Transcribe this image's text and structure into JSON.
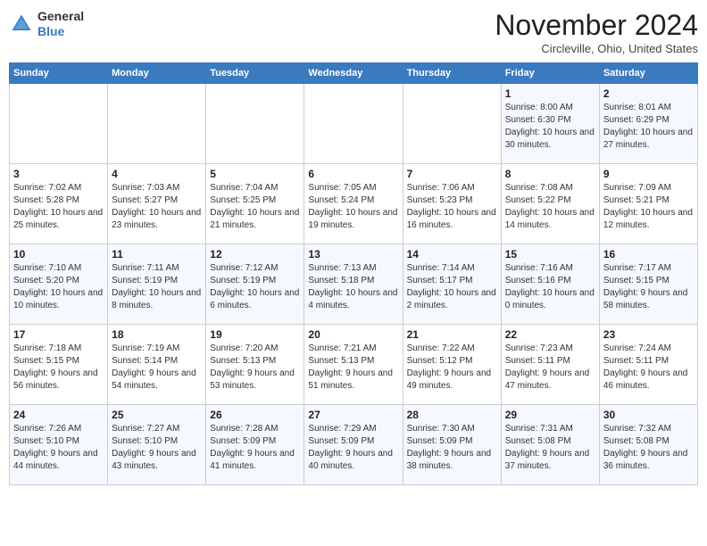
{
  "header": {
    "logo_line1": "General",
    "logo_line2": "Blue",
    "month_title": "November 2024",
    "location": "Circleville, Ohio, United States"
  },
  "weekdays": [
    "Sunday",
    "Monday",
    "Tuesday",
    "Wednesday",
    "Thursday",
    "Friday",
    "Saturday"
  ],
  "weeks": [
    [
      {
        "day": "",
        "info": ""
      },
      {
        "day": "",
        "info": ""
      },
      {
        "day": "",
        "info": ""
      },
      {
        "day": "",
        "info": ""
      },
      {
        "day": "",
        "info": ""
      },
      {
        "day": "1",
        "info": "Sunrise: 8:00 AM\nSunset: 6:30 PM\nDaylight: 10 hours and 30 minutes."
      },
      {
        "day": "2",
        "info": "Sunrise: 8:01 AM\nSunset: 6:29 PM\nDaylight: 10 hours and 27 minutes."
      }
    ],
    [
      {
        "day": "3",
        "info": "Sunrise: 7:02 AM\nSunset: 5:28 PM\nDaylight: 10 hours and 25 minutes."
      },
      {
        "day": "4",
        "info": "Sunrise: 7:03 AM\nSunset: 5:27 PM\nDaylight: 10 hours and 23 minutes."
      },
      {
        "day": "5",
        "info": "Sunrise: 7:04 AM\nSunset: 5:25 PM\nDaylight: 10 hours and 21 minutes."
      },
      {
        "day": "6",
        "info": "Sunrise: 7:05 AM\nSunset: 5:24 PM\nDaylight: 10 hours and 19 minutes."
      },
      {
        "day": "7",
        "info": "Sunrise: 7:06 AM\nSunset: 5:23 PM\nDaylight: 10 hours and 16 minutes."
      },
      {
        "day": "8",
        "info": "Sunrise: 7:08 AM\nSunset: 5:22 PM\nDaylight: 10 hours and 14 minutes."
      },
      {
        "day": "9",
        "info": "Sunrise: 7:09 AM\nSunset: 5:21 PM\nDaylight: 10 hours and 12 minutes."
      }
    ],
    [
      {
        "day": "10",
        "info": "Sunrise: 7:10 AM\nSunset: 5:20 PM\nDaylight: 10 hours and 10 minutes."
      },
      {
        "day": "11",
        "info": "Sunrise: 7:11 AM\nSunset: 5:19 PM\nDaylight: 10 hours and 8 minutes."
      },
      {
        "day": "12",
        "info": "Sunrise: 7:12 AM\nSunset: 5:19 PM\nDaylight: 10 hours and 6 minutes."
      },
      {
        "day": "13",
        "info": "Sunrise: 7:13 AM\nSunset: 5:18 PM\nDaylight: 10 hours and 4 minutes."
      },
      {
        "day": "14",
        "info": "Sunrise: 7:14 AM\nSunset: 5:17 PM\nDaylight: 10 hours and 2 minutes."
      },
      {
        "day": "15",
        "info": "Sunrise: 7:16 AM\nSunset: 5:16 PM\nDaylight: 10 hours and 0 minutes."
      },
      {
        "day": "16",
        "info": "Sunrise: 7:17 AM\nSunset: 5:15 PM\nDaylight: 9 hours and 58 minutes."
      }
    ],
    [
      {
        "day": "17",
        "info": "Sunrise: 7:18 AM\nSunset: 5:15 PM\nDaylight: 9 hours and 56 minutes."
      },
      {
        "day": "18",
        "info": "Sunrise: 7:19 AM\nSunset: 5:14 PM\nDaylight: 9 hours and 54 minutes."
      },
      {
        "day": "19",
        "info": "Sunrise: 7:20 AM\nSunset: 5:13 PM\nDaylight: 9 hours and 53 minutes."
      },
      {
        "day": "20",
        "info": "Sunrise: 7:21 AM\nSunset: 5:13 PM\nDaylight: 9 hours and 51 minutes."
      },
      {
        "day": "21",
        "info": "Sunrise: 7:22 AM\nSunset: 5:12 PM\nDaylight: 9 hours and 49 minutes."
      },
      {
        "day": "22",
        "info": "Sunrise: 7:23 AM\nSunset: 5:11 PM\nDaylight: 9 hours and 47 minutes."
      },
      {
        "day": "23",
        "info": "Sunrise: 7:24 AM\nSunset: 5:11 PM\nDaylight: 9 hours and 46 minutes."
      }
    ],
    [
      {
        "day": "24",
        "info": "Sunrise: 7:26 AM\nSunset: 5:10 PM\nDaylight: 9 hours and 44 minutes."
      },
      {
        "day": "25",
        "info": "Sunrise: 7:27 AM\nSunset: 5:10 PM\nDaylight: 9 hours and 43 minutes."
      },
      {
        "day": "26",
        "info": "Sunrise: 7:28 AM\nSunset: 5:09 PM\nDaylight: 9 hours and 41 minutes."
      },
      {
        "day": "27",
        "info": "Sunrise: 7:29 AM\nSunset: 5:09 PM\nDaylight: 9 hours and 40 minutes."
      },
      {
        "day": "28",
        "info": "Sunrise: 7:30 AM\nSunset: 5:09 PM\nDaylight: 9 hours and 38 minutes."
      },
      {
        "day": "29",
        "info": "Sunrise: 7:31 AM\nSunset: 5:08 PM\nDaylight: 9 hours and 37 minutes."
      },
      {
        "day": "30",
        "info": "Sunrise: 7:32 AM\nSunset: 5:08 PM\nDaylight: 9 hours and 36 minutes."
      }
    ]
  ]
}
